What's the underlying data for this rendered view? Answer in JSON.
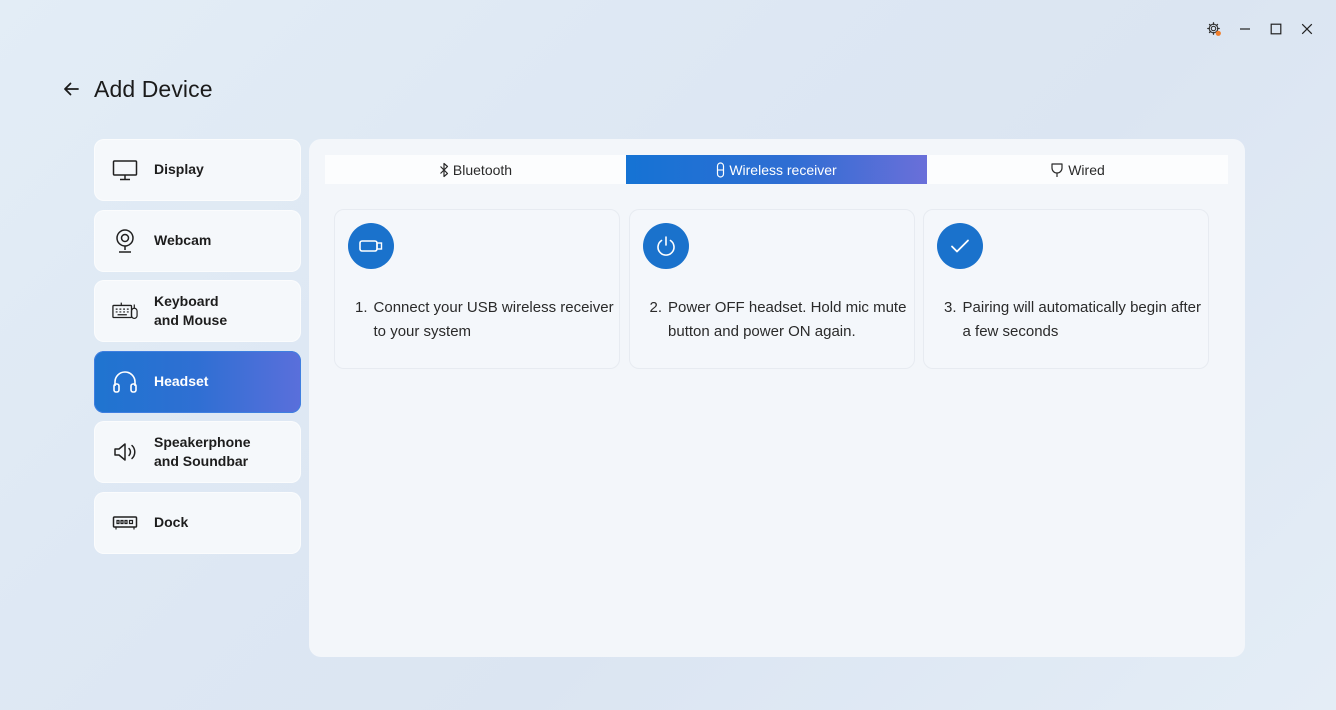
{
  "window": {
    "controls": [
      {
        "name": "settings-gear-icon",
        "label": "Settings"
      },
      {
        "name": "minimize-icon",
        "label": "Minimize"
      },
      {
        "name": "maximize-icon",
        "label": "Maximize"
      },
      {
        "name": "close-icon",
        "label": "Close"
      }
    ]
  },
  "header": {
    "title": "Add Device",
    "back_icon": "arrow-left-icon"
  },
  "sidebar": {
    "items": [
      {
        "label": "Display",
        "icon": "monitor-icon",
        "active": false
      },
      {
        "label": "Webcam",
        "icon": "webcam-icon",
        "active": false
      },
      {
        "label": "Keyboard\nand Mouse",
        "icon": "keyboard-mouse-icon",
        "active": false
      },
      {
        "label": "Headset",
        "icon": "headset-icon",
        "active": true
      },
      {
        "label": "Speakerphone\nand Soundbar",
        "icon": "speaker-icon",
        "active": false
      },
      {
        "label": "Dock",
        "icon": "dock-icon",
        "active": false
      }
    ]
  },
  "tabs": [
    {
      "label": "Bluetooth",
      "icon": "bluetooth-icon",
      "active": false
    },
    {
      "label": "Wireless receiver",
      "icon": "usb-dongle-icon",
      "active": true
    },
    {
      "label": "Wired",
      "icon": "plug-icon",
      "active": false
    }
  ],
  "steps": [
    {
      "number": "1.",
      "text": "Connect your USB wireless receiver to your system",
      "icon": "usb-receiver-icon"
    },
    {
      "number": "2.",
      "text": "Power OFF headset. Hold mic mute button and power ON again.",
      "icon": "power-icon"
    },
    {
      "number": "3.",
      "text": "Pairing will automatically begin after a few seconds",
      "icon": "checkmark-icon"
    }
  ],
  "colors": {
    "accent": "#1a72cc",
    "accent_gradient_end": "#6a6fd9",
    "notification_dot": "#f07d2a"
  }
}
